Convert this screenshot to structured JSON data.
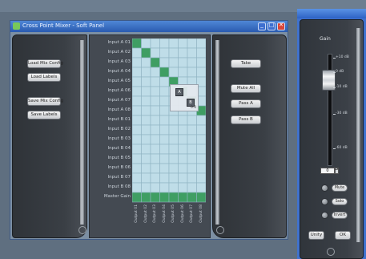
{
  "main_window": {
    "title": "Cross Point Mixer - Soft Panel",
    "buttons_left": [
      "Load Mix Config",
      "Load Labels",
      "Save Mix Config",
      "Save Labels"
    ],
    "buttons_right": [
      "Take",
      "Mute All",
      "Pass A",
      "Pass B"
    ],
    "row_labels": [
      "Input A 01",
      "Input A 02",
      "Input A 03",
      "Input A 04",
      "Input A 05",
      "Input A 06",
      "Input A 07",
      "Input A 08",
      "Input B 01",
      "Input B 02",
      "Input B 03",
      "Input B 04",
      "Input B 05",
      "Input B 06",
      "Input B 07",
      "Input B 08",
      "Master Gain"
    ],
    "column_labels": [
      "Output 01",
      "Output 02",
      "Output 03",
      "Output 04",
      "Output 05",
      "Output 06",
      "Output 07",
      "Output 08"
    ],
    "crosspoint_popup": {
      "marker_1": "A",
      "marker_2": "B",
      "label": "0.0"
    }
  },
  "gain_window": {
    "title": "Gain",
    "scale": [
      "+10 dB",
      "0 dB",
      "-10 dB",
      "-30 dB",
      "-60 dB"
    ],
    "value": "0",
    "spinner": "▴▾",
    "toggles": [
      "Mute",
      "Solo",
      "Invert"
    ],
    "buttons": [
      "Unity",
      "OK"
    ]
  },
  "colors": {
    "grid_fill": "#bfdde8",
    "grid_line": "#8fb3c2",
    "active_cell": "#3f9e63",
    "panel_dark": "#33383e"
  }
}
